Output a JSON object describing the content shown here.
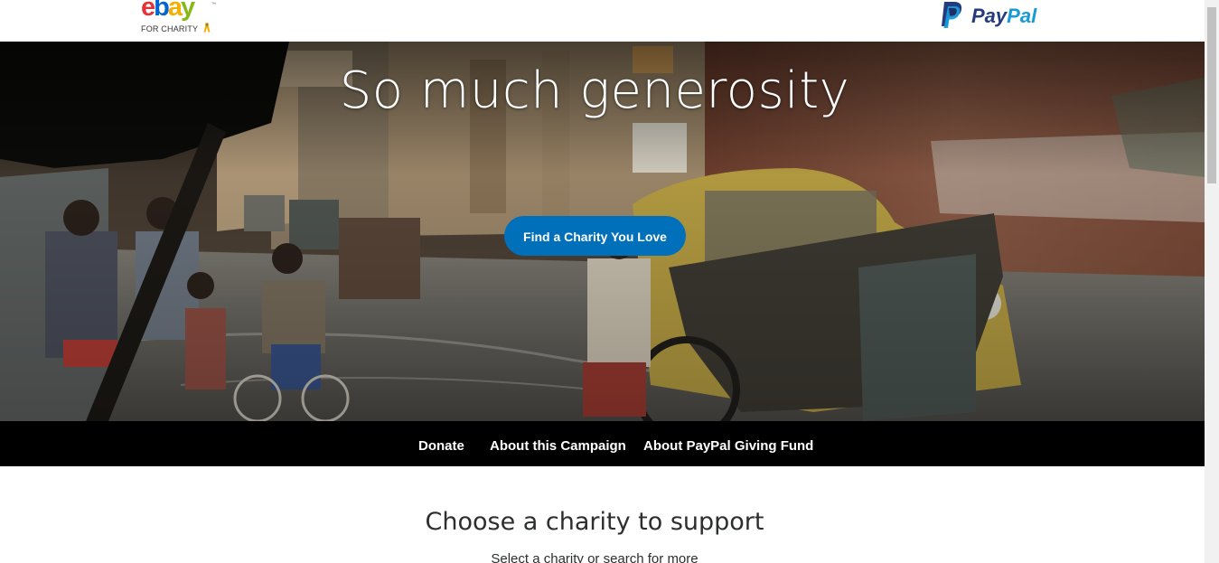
{
  "header": {
    "ebay_logo": {
      "letters": [
        "e",
        "b",
        "a",
        "y"
      ],
      "tm": "™",
      "tagline": "FOR CHARITY",
      "icon": "ribbon-icon"
    },
    "paypal_logo": {
      "word_part1": "Pay",
      "word_part2": "Pal",
      "icon": "paypal-p-icon"
    }
  },
  "hero": {
    "title": "So much generosity",
    "cta_label": "Find a Charity You Love"
  },
  "subnav": {
    "items": [
      {
        "label": "Donate"
      },
      {
        "label": "About this Campaign"
      },
      {
        "label": "About PayPal Giving Fund"
      }
    ]
  },
  "main": {
    "section_title": "Choose a charity to support",
    "section_subtitle": "Select a charity or search for more"
  },
  "colors": {
    "brand_blue": "#0070ba",
    "paypal_dark": "#253b80",
    "paypal_light": "#179bd7",
    "nav_bg": "#000000"
  }
}
